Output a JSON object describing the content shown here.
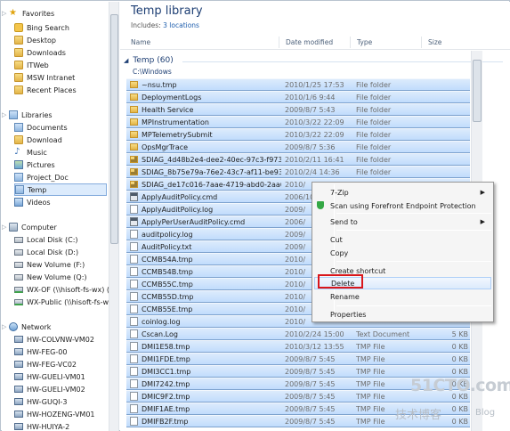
{
  "nav": {
    "favorites": {
      "label": "Favorites",
      "items": [
        "Bing Search",
        "Desktop",
        "Downloads",
        "ITWeb",
        "MSW Intranet",
        "Recent Places"
      ]
    },
    "libraries": {
      "label": "Libraries",
      "items": [
        "Documents",
        "Download",
        "Music",
        "Pictures",
        "Project_Doc",
        "Temp",
        "Videos"
      ]
    },
    "computer": {
      "label": "Computer",
      "items": [
        "Local Disk (C:)",
        "Local Disk (D:)",
        "New Volume (F:)",
        "New Volume (Q:)",
        "WX-OF (\\\\hisoft-fs-wx) (",
        "WX-Public (\\\\hisoft-fs-w"
      ]
    },
    "network": {
      "label": "Network",
      "items": [
        "HW-COLVNW-VM02",
        "HW-FEG-00",
        "HW-FEG-VC02",
        "HW-GUELI-VM01",
        "HW-GUELI-VM02",
        "HW-GUQI-3",
        "HW-HOZENG-VM01",
        "HW-HUIYA-2"
      ]
    }
  },
  "main": {
    "title": "Temp library",
    "includes_label": "Includes:",
    "includes_link": "3 locations",
    "columns": [
      "Name",
      "Date modified",
      "Type",
      "Size"
    ],
    "group": {
      "name": "Temp (60)",
      "path": "C:\\Windows"
    },
    "rows": [
      {
        "name": "~nsu.tmp",
        "date": "2010/1/25 17:53",
        "type": "File folder",
        "size": "",
        "icon": "folder",
        "selected": true
      },
      {
        "name": "DeploymentLogs",
        "date": "2010/1/6 9:44",
        "type": "File folder",
        "size": "",
        "icon": "folder",
        "selected": true
      },
      {
        "name": "Health Service",
        "date": "2009/8/7 5:43",
        "type": "File folder",
        "size": "",
        "icon": "folder",
        "selected": true
      },
      {
        "name": "MPInstrumentation",
        "date": "2010/3/22 22:09",
        "type": "File folder",
        "size": "",
        "icon": "folder",
        "selected": true
      },
      {
        "name": "MPTelemetrySubmit",
        "date": "2010/3/22 22:09",
        "type": "File folder",
        "size": "",
        "icon": "folder",
        "selected": true
      },
      {
        "name": "OpsMgrTrace",
        "date": "2009/8/7 5:36",
        "type": "File folder",
        "size": "",
        "icon": "folder",
        "selected": true
      },
      {
        "name": "SDIAG_4d48b2e4-dee2-40ec-97c3-f9730e...",
        "date": "2010/2/11 16:41",
        "type": "File folder",
        "size": "",
        "icon": "lockfolder",
        "selected": true
      },
      {
        "name": "SDIAG_8b75e79a-76e2-43c7-af11-be93f8...",
        "date": "2010/2/4 14:36",
        "type": "File folder",
        "size": "",
        "icon": "lockfolder",
        "selected": true
      },
      {
        "name": "SDIAG_de17c016-7aae-4719-abd0-2aa60...",
        "date": "2010/",
        "type": "",
        "size": "",
        "icon": "lockfolder",
        "selected": true
      },
      {
        "name": "ApplyAuditPolicy.cmd",
        "date": "2006/10",
        "type": "",
        "size": "",
        "icon": "cmd",
        "selected": true
      },
      {
        "name": "ApplyAuditPolicy.log",
        "date": "2009/",
        "type": "",
        "size": "",
        "icon": "file",
        "selected": true
      },
      {
        "name": "ApplyPerUserAuditPolicy.cmd",
        "date": "2006/",
        "type": "",
        "size": "",
        "icon": "cmd",
        "selected": true
      },
      {
        "name": "auditpolicy.log",
        "date": "2009/",
        "type": "",
        "size": "",
        "icon": "file",
        "selected": true
      },
      {
        "name": "AuditPolicy.txt",
        "date": "2009/",
        "type": "",
        "size": "",
        "icon": "file",
        "selected": true
      },
      {
        "name": "CCMB54A.tmp",
        "date": "2010/",
        "type": "",
        "size": "",
        "icon": "file",
        "selected": true
      },
      {
        "name": "CCMB54B.tmp",
        "date": "2010/",
        "type": "",
        "size": "",
        "icon": "file",
        "selected": true
      },
      {
        "name": "CCMB55C.tmp",
        "date": "2010/",
        "type": "",
        "size": "",
        "icon": "file",
        "selected": true
      },
      {
        "name": "CCMB55D.tmp",
        "date": "2010/",
        "type": "",
        "size": "",
        "icon": "file",
        "selected": true
      },
      {
        "name": "CCMB55E.tmp",
        "date": "2010/",
        "type": "",
        "size": "",
        "icon": "file",
        "selected": true
      },
      {
        "name": "coinlog.log",
        "date": "2010/",
        "type": "",
        "size": "",
        "icon": "file",
        "selected": true
      },
      {
        "name": "Cscan.Log",
        "date": "2010/2/24 15:00",
        "type": "Text Document",
        "size": "5 KB",
        "icon": "file",
        "selected": true
      },
      {
        "name": "DMI1E58.tmp",
        "date": "2010/3/12 13:55",
        "type": "TMP File",
        "size": "0 KB",
        "icon": "file",
        "selected": true
      },
      {
        "name": "DMI1FDE.tmp",
        "date": "2009/8/7 5:45",
        "type": "TMP File",
        "size": "0 KB",
        "icon": "file",
        "selected": true
      },
      {
        "name": "DMI3CC1.tmp",
        "date": "2009/8/7 5:45",
        "type": "TMP File",
        "size": "0 KB",
        "icon": "file",
        "selected": true
      },
      {
        "name": "DMI7242.tmp",
        "date": "2009/8/7 5:45",
        "type": "TMP File",
        "size": "0 KB",
        "icon": "file",
        "selected": true
      },
      {
        "name": "DMIC9F2.tmp",
        "date": "2009/8/7 5:45",
        "type": "TMP File",
        "size": "0 KB",
        "icon": "file",
        "selected": true
      },
      {
        "name": "DMIF1AE.tmp",
        "date": "2009/8/7 5:45",
        "type": "TMP File",
        "size": "0 KB",
        "icon": "file",
        "selected": true
      },
      {
        "name": "DMIFB2F.tmp",
        "date": "2009/8/7 5:45",
        "type": "TMP File",
        "size": "0 KB",
        "icon": "file",
        "selected": true
      }
    ]
  },
  "context_menu": {
    "items": [
      {
        "label": "7-Zip",
        "submenu": true
      },
      {
        "label": "Scan using Forefront Endpoint Protection",
        "icon": "shield-icon"
      },
      {
        "label": "Send to",
        "submenu": true
      },
      {
        "label": "Cut"
      },
      {
        "label": "Copy"
      },
      {
        "label": "Create shortcut"
      },
      {
        "label": "Delete",
        "highlighted": true
      },
      {
        "label": "Rename"
      },
      {
        "label": "Properties"
      }
    ],
    "arrow_glyph": "▶"
  },
  "watermark": {
    "logo": "51CTO.com",
    "tagline": "技术博客",
    "blog": "Blog"
  },
  "colors": {
    "accent": "#1e3f74",
    "selection": "#c1dcfc",
    "highlight_box": "#d9161b"
  }
}
